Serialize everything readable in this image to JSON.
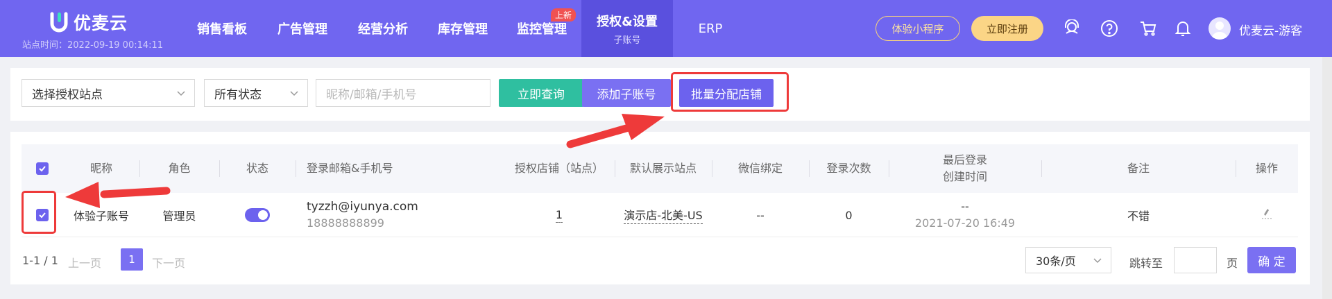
{
  "header": {
    "logo_text": "优麦云",
    "site_time": "站点时间：2022-09-19 00:14:11",
    "nav": [
      {
        "label": "销售看板",
        "sub": "",
        "badge": ""
      },
      {
        "label": "广告管理",
        "sub": "",
        "badge": ""
      },
      {
        "label": "经营分析",
        "sub": "",
        "badge": ""
      },
      {
        "label": "库存管理",
        "sub": "",
        "badge": ""
      },
      {
        "label": "监控管理",
        "sub": "",
        "badge": "上新"
      },
      {
        "label": "授权&设置",
        "sub": "子账号",
        "badge": "",
        "active": true
      },
      {
        "label": "ERP",
        "sub": "",
        "badge": ""
      }
    ],
    "mini_program_label": "体验小程序",
    "register_label": "立即注册",
    "icons": [
      "support-icon",
      "help-icon",
      "cart-icon",
      "bell-icon"
    ],
    "user_name": "优麦云-游客"
  },
  "filters": {
    "site_select": "选择授权站点",
    "status_select": "所有状态",
    "search_placeholder": "昵称/邮箱/手机号",
    "query_label": "立即查询",
    "add_label": "添加子账号",
    "batch_label": "批量分配店铺"
  },
  "table": {
    "columns": [
      "昵称",
      "角色",
      "状态",
      "登录邮箱&手机号",
      "授权店铺（站点）",
      "默认展示站点",
      "微信绑定",
      "登录次数",
      "最后登录",
      "创建时间",
      "备注",
      "操作"
    ],
    "rows": [
      {
        "nickname": "体验子账号",
        "role": "管理员",
        "status_on": true,
        "email": "tyzzh@iyunya.com",
        "phone": "18888888899",
        "shops": "1",
        "default_site": "演示店-北美-US",
        "wechat": "--",
        "login_count": "0",
        "last_login": "--",
        "created": "2021-07-20 16:49",
        "remark": "不错",
        "action_icon": "edit-icon"
      }
    ]
  },
  "pagination": {
    "total": "1-1 / 1",
    "prev": "上一页",
    "page": "1",
    "next": "下一页",
    "page_size": "30条/页",
    "jump_label": "跳转至",
    "page_unit": "页",
    "confirm": "确 定"
  },
  "colors": {
    "brand": "#7066f0",
    "accent_green": "#2fbfa0",
    "highlight_red": "#ee3a3a",
    "register_gold": "#fbd586"
  }
}
